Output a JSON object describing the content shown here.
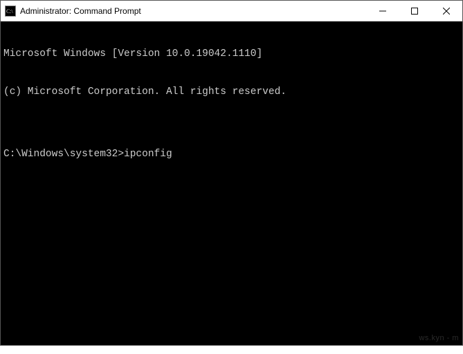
{
  "window": {
    "title": "Administrator: Command Prompt"
  },
  "terminal": {
    "line1": "Microsoft Windows [Version 10.0.19042.1110]",
    "line2": "(c) Microsoft Corporation. All rights reserved.",
    "blank": "",
    "prompt": "C:\\Windows\\system32>",
    "command": "ipconfig"
  },
  "watermark": "ws.kyn - m"
}
